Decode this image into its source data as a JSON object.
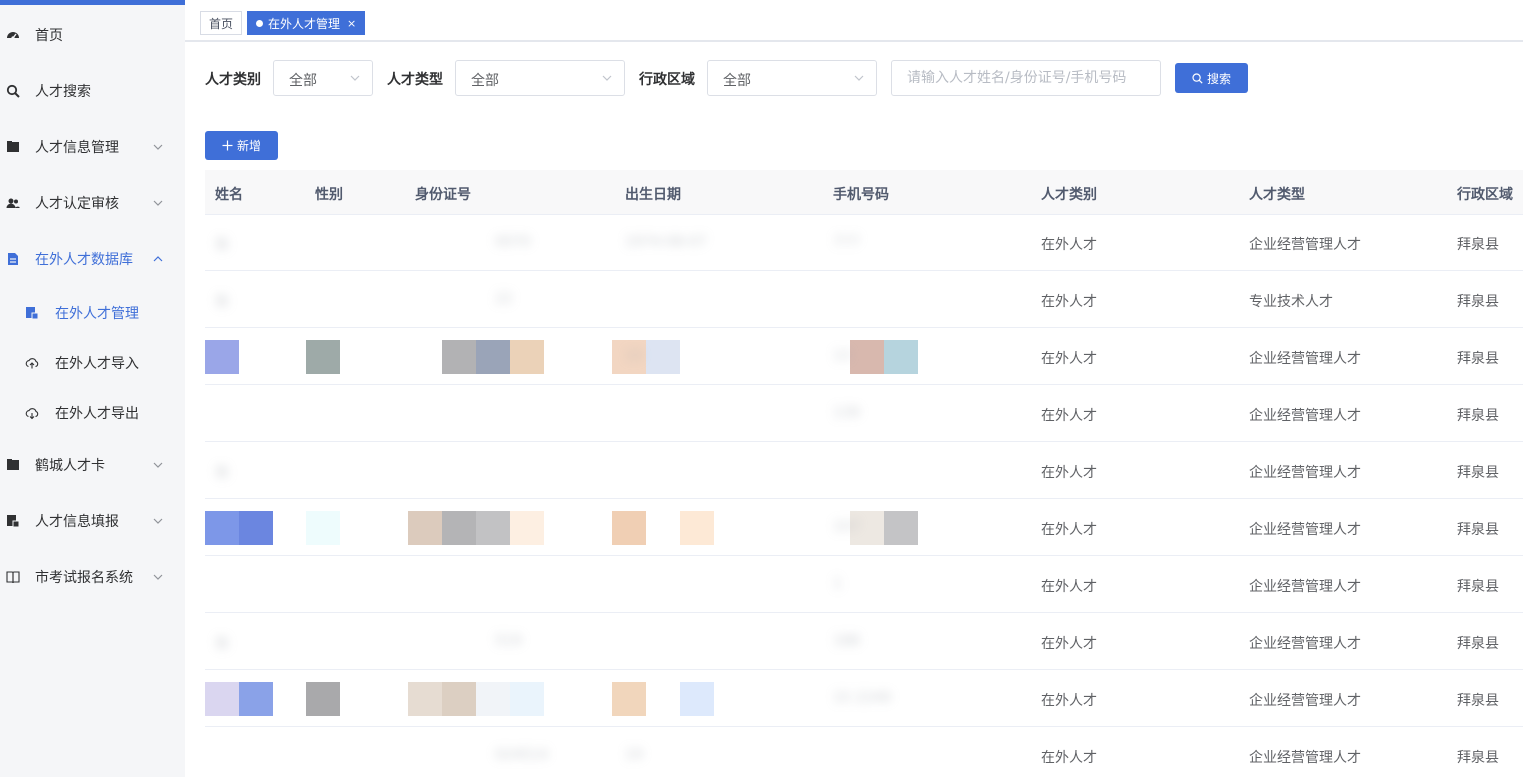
{
  "sidebar": {
    "items": [
      {
        "label": "首页",
        "icon": "dashboard-icon"
      },
      {
        "label": "人才搜索",
        "icon": "search-icon"
      },
      {
        "label": "人才信息管理",
        "icon": "folder-icon"
      },
      {
        "label": "人才认定审核",
        "icon": "users-icon"
      },
      {
        "label": "在外人才数据库",
        "icon": "document-icon"
      },
      {
        "label": "鹤城人才卡",
        "icon": "folder-icon"
      },
      {
        "label": "人才信息填报",
        "icon": "form-icon"
      },
      {
        "label": "市考试报名系统",
        "icon": "book-icon"
      }
    ],
    "subitems": [
      {
        "label": "在外人才管理",
        "icon": "list-icon"
      },
      {
        "label": "在外人才导入",
        "icon": "cloud-upload-icon"
      },
      {
        "label": "在外人才导出",
        "icon": "cloud-download-icon"
      }
    ]
  },
  "tabs": {
    "home": "首页",
    "current": "在外人才管理",
    "close": "×"
  },
  "filters": {
    "category_label": "人才类别",
    "category_value": "全部",
    "type_label": "人才类型",
    "type_value": "全部",
    "region_label": "行政区域",
    "region_value": "全部",
    "search_placeholder": "请输入人才姓名/身份证号/手机号码",
    "search_button": "搜索"
  },
  "toolbar": {
    "add_button": "新增"
  },
  "table": {
    "columns": [
      "姓名",
      "性别",
      "身份证号",
      "出生日期",
      "手机号码",
      "人才类别",
      "人才类型",
      "行政区域"
    ],
    "rows": [
      {
        "name": "张",
        "id": "0070",
        "birth": "1974-08-07",
        "phone": "777",
        "category": "在外人才",
        "type": "企业经营管理人才",
        "region": "拜泉县"
      },
      {
        "name": "张",
        "id": "22",
        "birth": "",
        "phone": "",
        "category": "在外人才",
        "type": "专业技术人才",
        "region": "拜泉县"
      },
      {
        "name": "",
        "id": "",
        "birth": "13",
        "phone": "13",
        "category": "在外人才",
        "type": "企业经营管理人才",
        "region": "拜泉县"
      },
      {
        "name": "",
        "id": "",
        "birth": "",
        "phone": "139",
        "category": "在外人才",
        "type": "企业经营管理人才",
        "region": "拜泉县"
      },
      {
        "name": "张",
        "id": "",
        "birth": "",
        "phone": "",
        "category": "在外人才",
        "type": "企业经营管理人才",
        "region": "拜泉县"
      },
      {
        "name": "",
        "id": "",
        "birth": "",
        "phone": "157",
        "category": "在外人才",
        "type": "企业经营管理人才",
        "region": "拜泉县"
      },
      {
        "name": "",
        "id": "",
        "birth": "",
        "phone": "1",
        "category": "在外人才",
        "type": "企业经营管理人才",
        "region": "拜泉县"
      },
      {
        "name": "张",
        "id": "519",
        "birth": "",
        "phone": "188",
        "category": "在外人才",
        "type": "企业经营管理人才",
        "region": "拜泉县"
      },
      {
        "name": "",
        "id": "",
        "birth": "",
        "phone": "15 2249",
        "category": "在外人才",
        "type": "企业经营管理人才",
        "region": "拜泉县"
      },
      {
        "name": "",
        "id": "024514",
        "birth": "19",
        "phone": "",
        "category": "在外人才",
        "type": "企业经营管理人才",
        "region": "拜泉县"
      }
    ]
  },
  "colors": {
    "primary": "#3f6fd8",
    "sidebar_bg": "#f5f6f8",
    "header_bg": "#f8f8f9"
  }
}
